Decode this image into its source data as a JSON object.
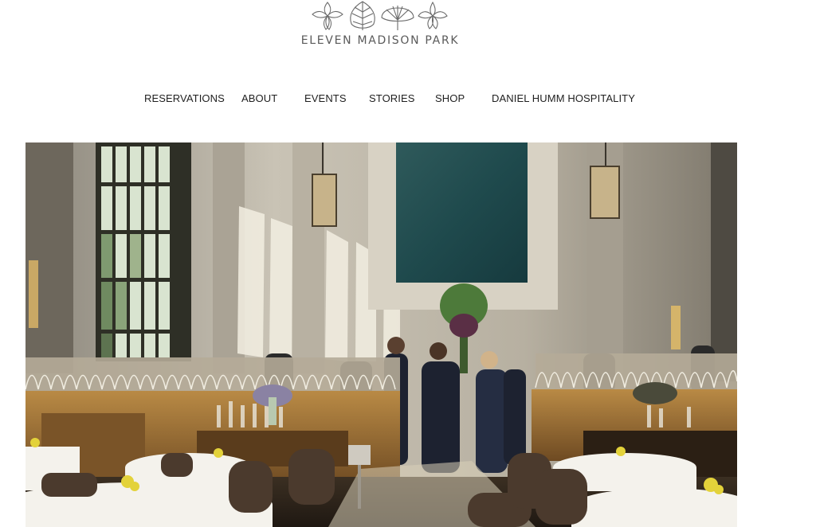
{
  "logo": {
    "name": "ELEVEN MADISON PARK",
    "icon": "leaf-mark-icon",
    "color": "#5a5a5a"
  },
  "nav": {
    "items": [
      {
        "label": "RESERVATIONS"
      },
      {
        "label": "ABOUT"
      },
      {
        "label": "EVENTS"
      },
      {
        "label": "STORIES"
      },
      {
        "label": "SHOP"
      },
      {
        "label": "DANIEL HUMM HOSPITALITY"
      }
    ]
  },
  "hero": {
    "alt": "Eleven Madison Park dining room"
  },
  "colors": {
    "background": "#ffffff",
    "text": "#1f1f1f"
  }
}
